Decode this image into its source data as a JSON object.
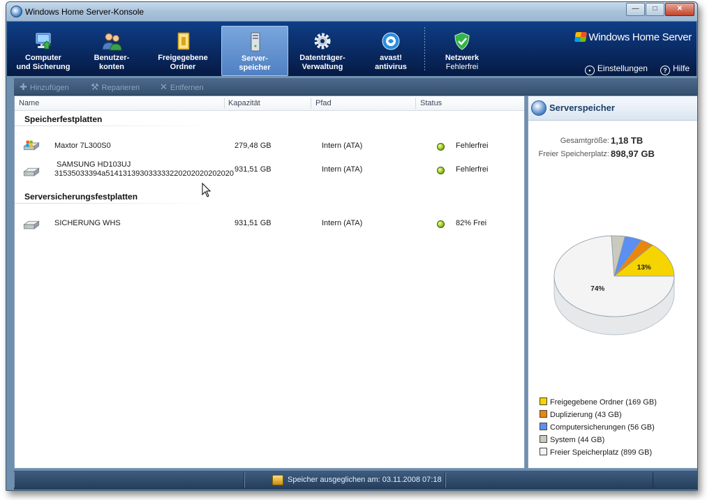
{
  "window": {
    "title": "Windows Home Server-Konsole"
  },
  "nav": {
    "tabs": [
      {
        "label": "Computer\nund Sicherung",
        "icon": "computer-icon"
      },
      {
        "label": "Benutzer-\nkonten",
        "icon": "users-icon"
      },
      {
        "label": "Freigegebene\nOrdner",
        "icon": "folder-icon"
      },
      {
        "label": "Server-\nspeicher",
        "icon": "server-storage-icon",
        "active": true
      },
      {
        "label": "Datenträger-\nVerwaltung",
        "icon": "gear-icon"
      },
      {
        "label": "avast!\nantivirus",
        "icon": "avast-icon"
      }
    ],
    "network": {
      "label": "Netzwerk",
      "status": "Fehlerfrei",
      "icon": "shield-check-icon"
    },
    "brand": "Windows Home Server",
    "settings_label": "Einstellungen",
    "help_label": "Hilfe"
  },
  "toolbar": {
    "add_label": "Hinzufügen",
    "repair_label": "Reparieren",
    "remove_label": "Entfernen"
  },
  "table": {
    "columns": {
      "name": "Name",
      "capacity": "Kapazität",
      "path": "Pfad",
      "status": "Status"
    },
    "groups": [
      {
        "title": "Speicherfestplatten",
        "rows": [
          {
            "name": "Maxtor 7L300S0",
            "name2": "",
            "capacity": "279,48 GB",
            "path": "Intern (ATA)",
            "status": "Fehlerfrei",
            "icon": "system-disk-icon"
          },
          {
            "name": "SAMSUNG HD103UJ",
            "name2": "31535033394a514131393033333220202020202020",
            "capacity": "931,51 GB",
            "path": "Intern (ATA)",
            "status": "Fehlerfrei",
            "icon": "hard-disk-icon"
          }
        ]
      },
      {
        "title": "Serversicherungsfestplatten",
        "rows": [
          {
            "name": "SICHERUNG WHS",
            "name2": "",
            "capacity": "931,51 GB",
            "path": "Intern (ATA)",
            "status": "82% Frei",
            "icon": "hard-disk-icon"
          }
        ]
      }
    ]
  },
  "storage": {
    "title": "Serverspeicher",
    "total_label": "Gesamtgröße:",
    "total_value": "1,18 TB",
    "free_label": "Freier Speicherplatz:",
    "free_value": "898,97 GB"
  },
  "chart_data": {
    "type": "pie",
    "title": "",
    "slices": [
      {
        "label": "Freigegebene Ordner (169 GB)",
        "value": 169,
        "color": "#f5d400",
        "data_label": "13%"
      },
      {
        "label": "Duplizierung (43 GB)",
        "value": 43,
        "color": "#e8870c",
        "data_label": ""
      },
      {
        "label": "Computersicherungen (56 GB)",
        "value": 56,
        "color": "#5b8ff0",
        "data_label": ""
      },
      {
        "label": "System (44 GB)",
        "value": 44,
        "color": "#c9c9bd",
        "data_label": ""
      },
      {
        "label": "Freier Speicherplatz (899 GB)",
        "value": 899,
        "color": "#f4f4f4",
        "data_label": "74%"
      }
    ],
    "legend_position": "bottom"
  },
  "statusbar": {
    "text": "Speicher ausgeglichen am: 03.11.2008 07:18"
  }
}
